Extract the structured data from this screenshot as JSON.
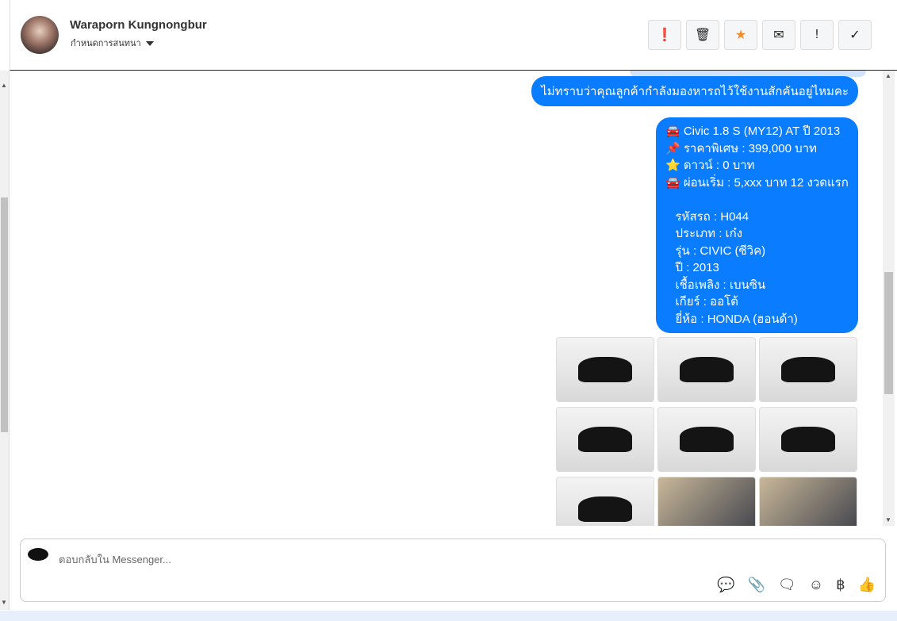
{
  "header": {
    "contact_name": "Waraporn Kungnongbur",
    "subtitle": "กำหนดการสนทนา",
    "actions": [
      {
        "icon": "alert-circle-icon",
        "glyph": "❗"
      },
      {
        "icon": "trash-icon",
        "glyph": "🗑"
      },
      {
        "icon": "star-icon",
        "glyph": "★",
        "color": "#f28c28"
      },
      {
        "icon": "envelope-icon",
        "glyph": "✉"
      },
      {
        "icon": "exclamation-icon",
        "glyph": "!"
      },
      {
        "icon": "check-icon",
        "glyph": "✓"
      }
    ]
  },
  "messages": [
    {
      "text": "ไม่ทราบว่าคุณลูกค้ากำลังมองหารถไว้ใช้งานสักคันอยู่ไหมคะ"
    },
    {
      "text": "🚘 Civic 1.8 S (MY12) AT ปี 2013\n📌 ราคาพิเศษ : 399,000 บาท\n⭐ ดาวน์ : 0 บาท\n🚘 ผ่อนเริ่ม : 5,xxx บาท 12 งวดแรก\n\n   รหัสรถ : H044\n   ประเภท : เก๋ง\n   รุ่น : CIVIC (ซีวิค)\n   ปี : 2013\n   เชื้อเพลิง : เบนซิน\n   เกียร์ : ออโต้\n   ยี่ห้อ : HONDA (ฮอนด้า)"
    }
  ],
  "photos": [
    "exterior",
    "exterior",
    "exterior",
    "exterior",
    "exterior",
    "exterior",
    "exterior",
    "interior",
    "interior"
  ],
  "composer": {
    "placeholder": "ตอบกลับใน Messenger...",
    "tools": [
      {
        "icon": "saved-reply-icon",
        "glyph": "💬"
      },
      {
        "icon": "paperclip-icon",
        "glyph": "📎"
      },
      {
        "icon": "chat-bubble-icon",
        "glyph": "🗨"
      },
      {
        "icon": "emoji-icon",
        "glyph": "☺"
      },
      {
        "icon": "baht-icon",
        "glyph": "฿"
      },
      {
        "icon": "thumbs-up-icon",
        "glyph": "👍"
      }
    ]
  },
  "colors": {
    "bubble": "#0a7cff"
  }
}
